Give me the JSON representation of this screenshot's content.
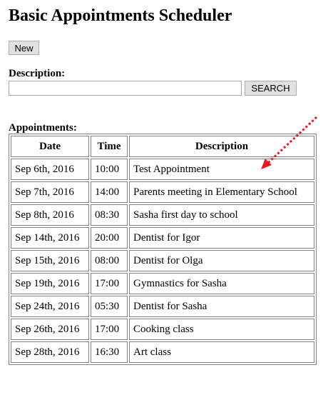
{
  "page": {
    "title": "Basic Appointments Scheduler"
  },
  "toolbar": {
    "new_label": "New"
  },
  "search": {
    "label": "Description:",
    "value": "",
    "placeholder": "",
    "button_label": "SEARCH"
  },
  "appointments": {
    "label": "Appointments:",
    "headers": [
      "Date",
      "Time",
      "Description"
    ],
    "rows": [
      {
        "date": "Sep 6th, 2016",
        "time": "10:00",
        "description": "Test Appointment"
      },
      {
        "date": "Sep 7th, 2016",
        "time": "14:00",
        "description": "Parents meeting in Elementary School"
      },
      {
        "date": "Sep 8th, 2016",
        "time": "08:30",
        "description": "Sasha first day to school"
      },
      {
        "date": "Sep 14th, 2016",
        "time": "20:00",
        "description": "Dentist for Igor"
      },
      {
        "date": "Sep 15th, 2016",
        "time": "08:00",
        "description": "Dentist for Olga"
      },
      {
        "date": "Sep 19th, 2016",
        "time": "17:00",
        "description": "Gymnastics for Sasha"
      },
      {
        "date": "Sep 24th, 2016",
        "time": "05:30",
        "description": "Dentist for Sasha"
      },
      {
        "date": "Sep 26th, 2016",
        "time": "17:00",
        "description": "Cooking class"
      },
      {
        "date": "Sep 28th, 2016",
        "time": "16:30",
        "description": "Art class"
      }
    ]
  },
  "annotation": {
    "arrow_color": "#e8181f",
    "icon": "dotted-arrow-icon"
  }
}
